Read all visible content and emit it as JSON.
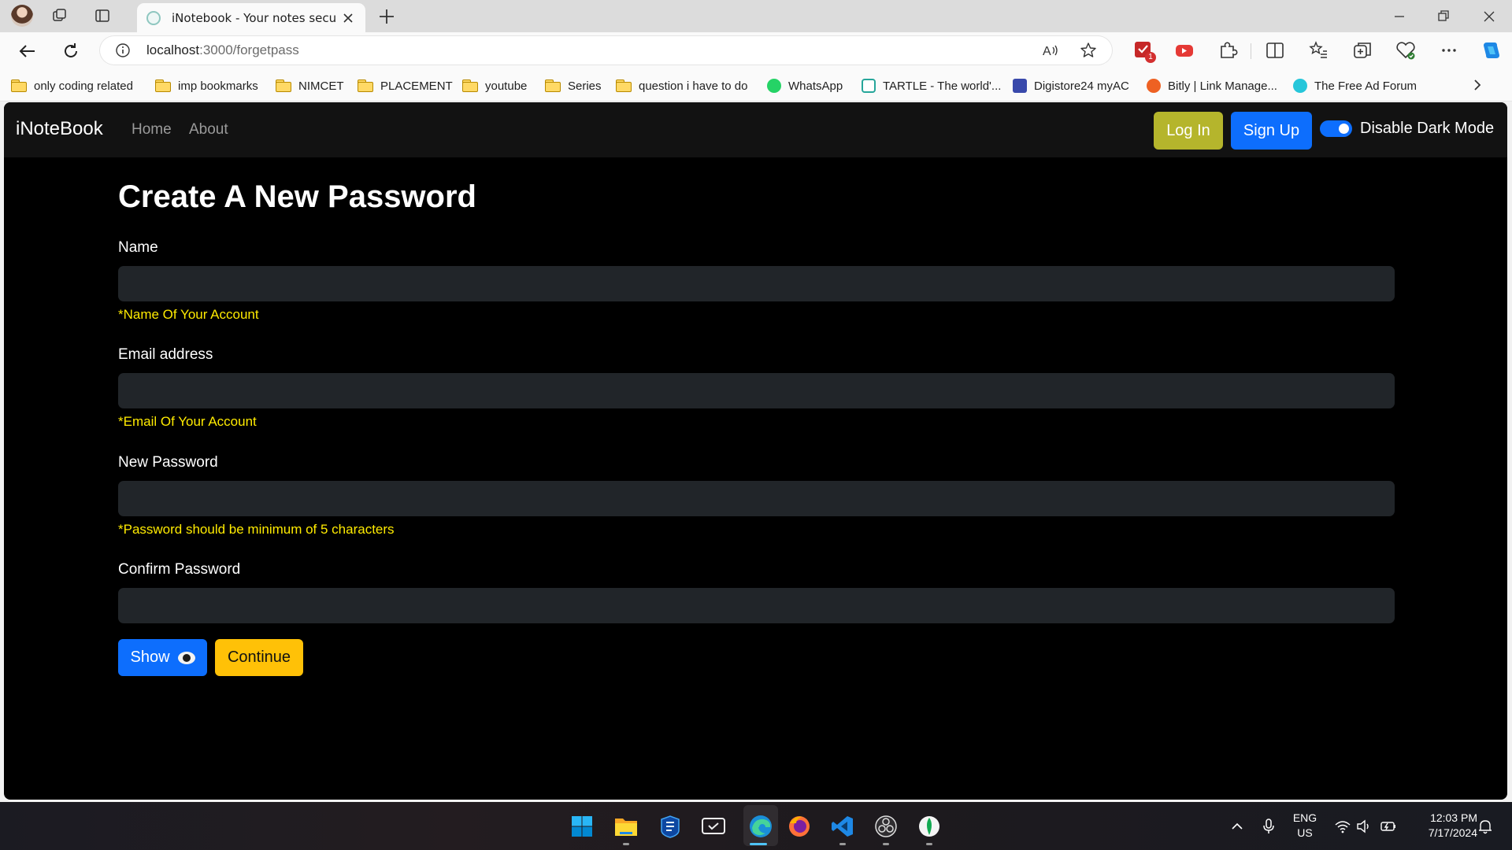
{
  "browser": {
    "tab_title": "iNotebook - Your notes secured",
    "url_host": "localhost",
    "url_rest": ":3000/forgetpass",
    "bookmarks": [
      {
        "label": "only coding  related",
        "icon": "folder-icon"
      },
      {
        "label": "imp bookmarks",
        "icon": "folder-icon"
      },
      {
        "label": "NIMCET",
        "icon": "folder-icon"
      },
      {
        "label": "PLACEMENT",
        "icon": "folder-icon"
      },
      {
        "label": "youtube",
        "icon": "folder-icon"
      },
      {
        "label": "Series",
        "icon": "folder-icon"
      },
      {
        "label": "question i have to do",
        "icon": "folder-icon"
      },
      {
        "label": "WhatsApp",
        "icon": "whatsapp-icon"
      },
      {
        "label": "TARTLE - The world'...",
        "icon": "tartle-icon"
      },
      {
        "label": "Digistore24 myAC",
        "icon": "digistore-icon"
      },
      {
        "label": "Bitly | Link Manage...",
        "icon": "bitly-icon"
      },
      {
        "label": "The Free Ad Forum",
        "icon": "ad-forum-icon"
      }
    ],
    "extension_badge": "1"
  },
  "app": {
    "brand": "iNoteBook",
    "nav_links": [
      "Home",
      "About"
    ],
    "login_label": "Log In",
    "signup_label": "Sign Up",
    "dark_mode_label": "Disable Dark Mode",
    "dark_mode_on": true
  },
  "form": {
    "title": "Create A New Password",
    "name_label": "Name",
    "name_hint": "*Name Of Your Account",
    "email_label": "Email address",
    "email_hint": "*Email Of Your Account",
    "new_password_label": "New Password",
    "new_password_hint": "*Password should be minimum of 5 characters",
    "confirm_password_label": "Confirm Password",
    "show_label": "Show",
    "continue_label": "Continue"
  },
  "taskbar": {
    "language": "ENG",
    "region": "US",
    "time": "12:03 PM",
    "date": "7/17/2024"
  },
  "colors": {
    "accent_blue": "#0d6efd",
    "login_olive": "#b5b52c",
    "continue_yellow": "#ffc107",
    "hint_yellow": "#ffeb00",
    "input_bg": "#212529"
  }
}
